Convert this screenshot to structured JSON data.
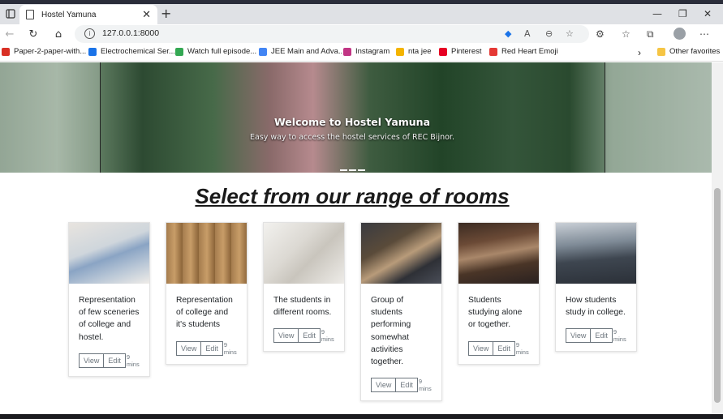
{
  "browser": {
    "tab_title": "Hostel Yamuna",
    "url": "127.0.0.1:8000",
    "other_favorites": "Other favorites",
    "bookmarks": [
      {
        "label": "Paper-2-paper-with...",
        "color": "#d93025"
      },
      {
        "label": "Electrochemical Ser...",
        "color": "#1a73e8"
      },
      {
        "label": "Watch full episode...",
        "color": "#34a853"
      },
      {
        "label": "JEE Main and Adva...",
        "color": "#4285f4"
      },
      {
        "label": "Instagram",
        "color": "#c13584"
      },
      {
        "label": "nta jee",
        "color": "#f4b400"
      },
      {
        "label": "Pinterest",
        "color": "#e60023"
      },
      {
        "label": "Red Heart Emoji",
        "color": "#e53935"
      }
    ]
  },
  "hero": {
    "title": "Welcome to Hostel Yamuna",
    "subtitle": "Easy way to access the hostel services of REC Bijnor."
  },
  "main": {
    "heading": "Select from our range of rooms",
    "cards": [
      {
        "text": "Representation of few sceneries of college and hostel.",
        "view": "View",
        "edit": "Edit",
        "time": "9 mins"
      },
      {
        "text": "Representation of college and it's students",
        "view": "View",
        "edit": "Edit",
        "time": "9 mins"
      },
      {
        "text": "The students in different rooms.",
        "view": "View",
        "edit": "Edit",
        "time": "9 mins"
      },
      {
        "text": "Group of students performing somewhat activities together.",
        "view": "View",
        "edit": "Edit",
        "time": "9 mins"
      },
      {
        "text": "Students studying alone or together.",
        "view": "View",
        "edit": "Edit",
        "time": "9 mins"
      },
      {
        "text": "How students study in college.",
        "view": "View",
        "edit": "Edit",
        "time": "9 mins"
      }
    ]
  }
}
